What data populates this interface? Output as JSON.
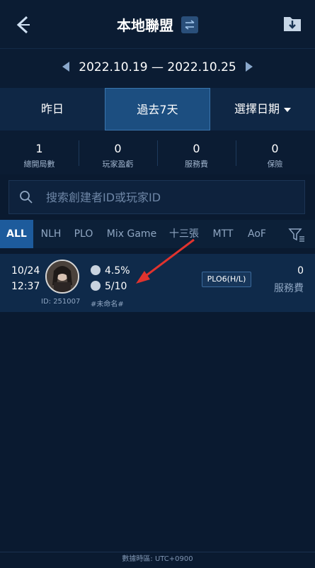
{
  "header": {
    "title": "本地聯盟",
    "back_icon": "back-arrow-icon",
    "swap_icon": "swap-icon",
    "download_icon": "download-icon"
  },
  "date_range": {
    "text": "2022.10.19 — 2022.10.25"
  },
  "tabs": [
    {
      "label": "昨日",
      "active": false
    },
    {
      "label": "過去7天",
      "active": true
    },
    {
      "label": "選擇日期",
      "active": false
    }
  ],
  "stats": [
    {
      "value": "1",
      "label": "總開局數"
    },
    {
      "value": "0",
      "label": "玩家盈虧"
    },
    {
      "value": "0",
      "label": "服務費"
    },
    {
      "value": "0",
      "label": "保險"
    }
  ],
  "search": {
    "placeholder": "搜索創建者ID或玩家ID"
  },
  "filters": [
    "ALL",
    "NLH",
    "PLO",
    "Mix Game",
    "十三張",
    "MTT",
    "AoF"
  ],
  "rows": [
    {
      "date": "10/24",
      "time": "12:37",
      "rake": "4.5%",
      "players": "5/10",
      "game_id": "ID: 251007",
      "club": "#未命名#",
      "game_type": "PLO6(H/L)",
      "fee_value": "0",
      "fee_label": "服務費"
    }
  ],
  "footer": {
    "text": "數據時區: UTC+0900"
  },
  "colors": {
    "background": "#0a1a30",
    "active_tab": "#1c4e80",
    "active_filter": "#1d5b9c",
    "annotation_arrow": "#e0332e"
  }
}
